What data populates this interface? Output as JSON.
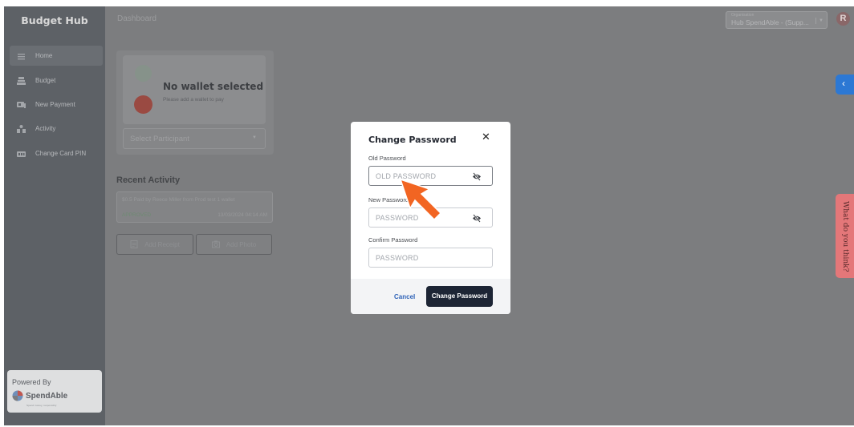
{
  "sidebar": {
    "brand": "Budget Hub",
    "items": [
      {
        "label": "Home",
        "icon": "home-icon",
        "active": true
      },
      {
        "label": "Budget",
        "icon": "budget-icon",
        "active": false
      },
      {
        "label": "New Payment",
        "icon": "payment-icon",
        "active": false
      },
      {
        "label": "Activity",
        "icon": "activity-icon",
        "active": false
      },
      {
        "label": "Change Card PIN",
        "icon": "pin-icon",
        "active": false
      }
    ],
    "powered_by": "Powered By",
    "logo_text": "SpendAble",
    "logo_tagline": "Spend money, responsibly"
  },
  "header": {
    "breadcrumb": "Dashboard",
    "org_label": "Organisation",
    "org_value": "Hub SpendAble - (Supp...",
    "avatar_initial": "R"
  },
  "wallet": {
    "title": "No wallet selected",
    "subtitle": "Please add a wallet to pay",
    "participant_placeholder": "Select Participant"
  },
  "recent": {
    "title": "Recent Activity",
    "item": {
      "description": "$0.5 Paid by Reece Miller from Prod test 1 wallet",
      "status": "APPROVED",
      "timestamp": "13/03/2024 04:14 AM"
    },
    "add_receipt": "Add Receipt",
    "add_photo": "Add Photo"
  },
  "feedback_tab": "What do you think?",
  "modal": {
    "title": "Change Password",
    "old_label": "Old Password",
    "old_placeholder": "OLD PASSWORD",
    "new_label": "New Password",
    "new_placeholder": "PASSWORD",
    "confirm_label": "Confirm Password",
    "confirm_placeholder": "PASSWORD",
    "cancel": "Cancel",
    "submit": "Change Password"
  },
  "colors": {
    "primary_button": "#1d2535",
    "cancel_link": "#2f63b8",
    "side_tab_blue": "#2c78d4",
    "feedback_tab": "#e47779",
    "pointer_arrow": "#f26522"
  }
}
